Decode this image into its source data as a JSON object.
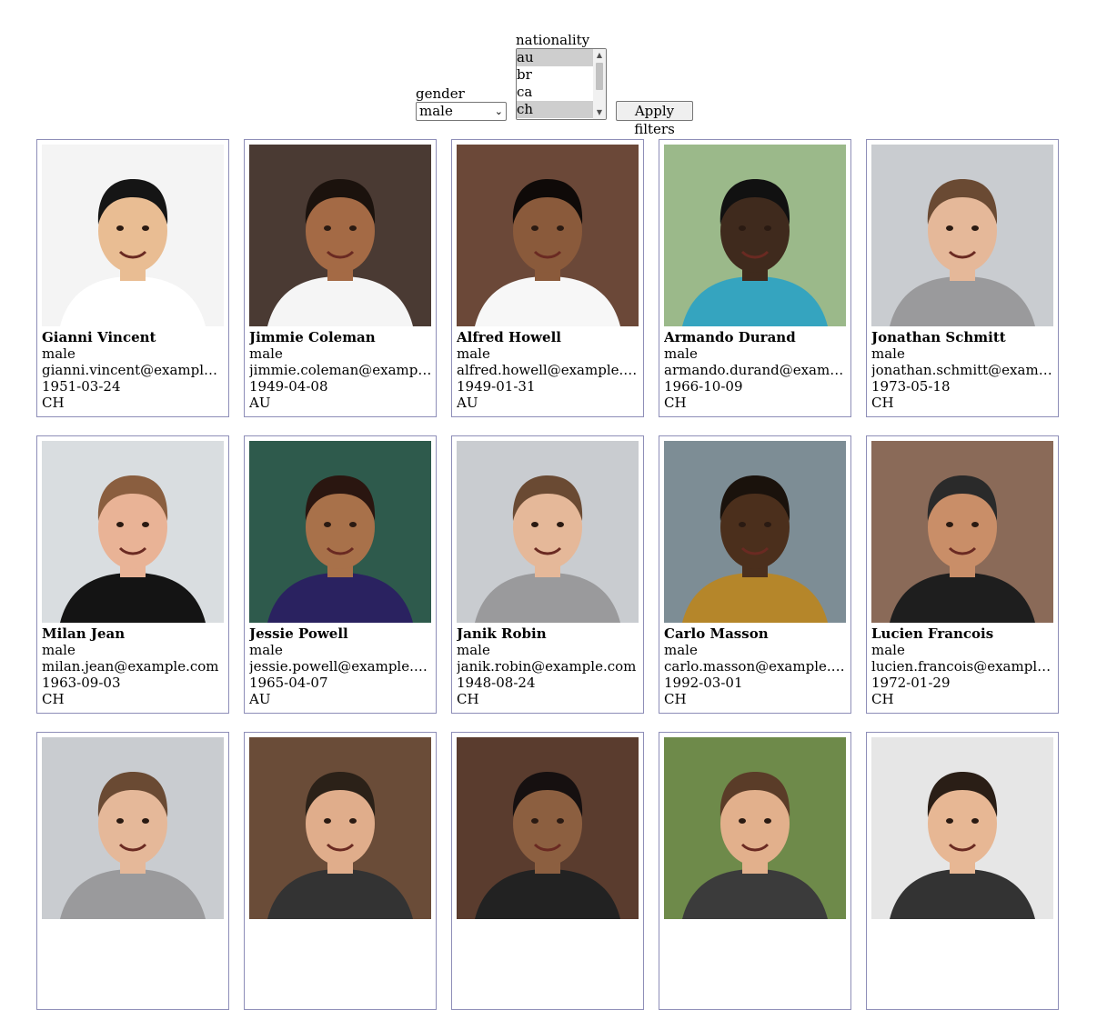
{
  "filters": {
    "gender_label": "gender",
    "gender_value": "male",
    "nationality_label": "nationality",
    "nationality_options": [
      {
        "label": "au",
        "selected": true
      },
      {
        "label": "br",
        "selected": false
      },
      {
        "label": "ca",
        "selected": false
      },
      {
        "label": "ch",
        "selected": true
      }
    ],
    "apply_label": "Apply filters"
  },
  "people": [
    {
      "name": "Gianni Vincent",
      "gender": "male",
      "email": "gianni.vincent@example.com",
      "dob": "1951-03-24",
      "nat": "CH",
      "bg": "#f4f4f4",
      "skin": "#e9bd93",
      "hair": "#151515",
      "shirt": "#ffffff"
    },
    {
      "name": "Jimmie Coleman",
      "gender": "male",
      "email": "jimmie.coleman@example.com",
      "dob": "1949-04-08",
      "nat": "AU",
      "bg": "#4a3a33",
      "skin": "#a46a45",
      "hair": "#1b120d",
      "shirt": "#f5f5f5"
    },
    {
      "name": "Alfred Howell",
      "gender": "male",
      "email": "alfred.howell@example.com",
      "dob": "1949-01-31",
      "nat": "AU",
      "bg": "#6b4838",
      "skin": "#8a5a3b",
      "hair": "#0f0a08",
      "shirt": "#f7f7f7"
    },
    {
      "name": "Armando Durand",
      "gender": "male",
      "email": "armando.durand@example.com",
      "dob": "1966-10-09",
      "nat": "CH",
      "bg": "#9bb98a",
      "skin": "#3f2a1d",
      "hair": "#111111",
      "shirt": "#35a4bf"
    },
    {
      "name": "Jonathan Schmitt",
      "gender": "male",
      "email": "jonathan.schmitt@example.com",
      "dob": "1973-05-18",
      "nat": "CH",
      "bg": "#c9ccd0",
      "skin": "#e5b899",
      "hair": "#6a4a33",
      "shirt": "#9a9a9c"
    },
    {
      "name": "Milan Jean",
      "gender": "male",
      "email": "milan.jean@example.com",
      "dob": "1963-09-03",
      "nat": "CH",
      "bg": "#d9dde0",
      "skin": "#e9b396",
      "hair": "#8a5e3f",
      "shirt": "#141414"
    },
    {
      "name": "Jessie Powell",
      "gender": "male",
      "email": "jessie.powell@example.com",
      "dob": "1965-04-07",
      "nat": "AU",
      "bg": "#2e5a4c",
      "skin": "#a8714a",
      "hair": "#2a1610",
      "shirt": "#2a2260"
    },
    {
      "name": "Janik Robin",
      "gender": "male",
      "email": "janik.robin@example.com",
      "dob": "1948-08-24",
      "nat": "CH",
      "bg": "#c9ccd0",
      "skin": "#e5b899",
      "hair": "#6a4a33",
      "shirt": "#9a9a9c"
    },
    {
      "name": "Carlo Masson",
      "gender": "male",
      "email": "carlo.masson@example.com",
      "dob": "1992-03-01",
      "nat": "CH",
      "bg": "#7d8d95",
      "skin": "#4b2f1c",
      "hair": "#1a120c",
      "shirt": "#b5862a"
    },
    {
      "name": "Lucien Francois",
      "gender": "male",
      "email": "lucien.francois@example.com",
      "dob": "1972-01-29",
      "nat": "CH",
      "bg": "#8a6a58",
      "skin": "#c98e68",
      "hair": "#2a2a2a",
      "shirt": "#1e1e1e"
    },
    {
      "name": "",
      "gender": "",
      "email": "",
      "dob": "",
      "nat": "",
      "bg": "#c9ccd0",
      "skin": "#e5b899",
      "hair": "#6a4a33",
      "shirt": "#9a9a9c"
    },
    {
      "name": "",
      "gender": "",
      "email": "",
      "dob": "",
      "nat": "",
      "bg": "#6a4c38",
      "skin": "#e0ad8b",
      "hair": "#2b2118",
      "shirt": "#333333"
    },
    {
      "name": "",
      "gender": "",
      "email": "",
      "dob": "",
      "nat": "",
      "bg": "#5a3c2e",
      "skin": "#8c5f40",
      "hair": "#161010",
      "shirt": "#222222"
    },
    {
      "name": "",
      "gender": "",
      "email": "",
      "dob": "",
      "nat": "",
      "bg": "#6e8a4a",
      "skin": "#e2b08c",
      "hair": "#5a3c28",
      "shirt": "#3b3b3b"
    },
    {
      "name": "",
      "gender": "",
      "email": "",
      "dob": "",
      "nat": "",
      "bg": "#e6e6e6",
      "skin": "#e7b794",
      "hair": "#2a1e16",
      "shirt": "#333333"
    }
  ]
}
